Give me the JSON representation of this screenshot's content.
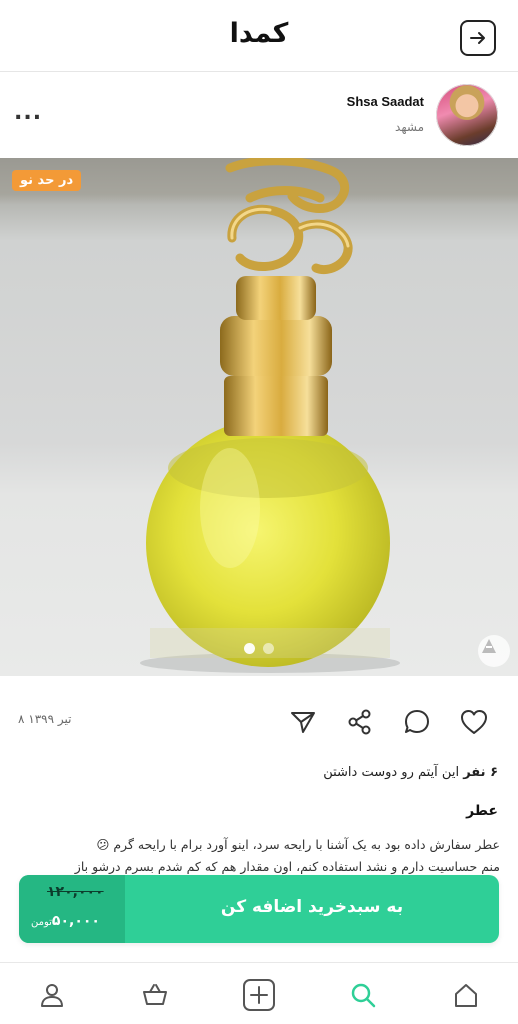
{
  "header": {
    "brand": "کمدا",
    "back_icon": "arrow-right-box-icon"
  },
  "seller": {
    "name": "Shsa Saadat",
    "city": "مشهد",
    "more": "..."
  },
  "product": {
    "condition": "در حد نو",
    "gallery": {
      "total": 2,
      "current": 1
    },
    "date": "۸ تیر ۱۳۹۹",
    "likes_count": "۶ نفر",
    "likes_text": "این آیتم رو دوست داشتن",
    "title": "عطر",
    "description_line1": "عطر سفارش داده بود به یک آشنا با رایحه سرد، اینو آورد برام با رایحه گرم 😕",
    "description_line2": "منم حساسیت دارم و نشد استفاده کنم، اون مقدار هم که کم شدم بسرم درشو باز"
  },
  "purchase": {
    "old_price": "۱۲۰,۰۰۰",
    "new_price": "۵۰,۰۰۰",
    "currency": "تومن",
    "button_label": "به سبدخرید اضافه کن"
  },
  "colors": {
    "accent": "#2fcf97",
    "accent_dark": "#25b783",
    "badge": "#f39a37"
  },
  "nav": [
    {
      "id": "profile",
      "icon": "user-icon"
    },
    {
      "id": "basket",
      "icon": "basket-icon"
    },
    {
      "id": "add",
      "icon": "plus-box-icon"
    },
    {
      "id": "search",
      "icon": "search-icon",
      "active": true
    },
    {
      "id": "home",
      "icon": "home-icon"
    }
  ]
}
